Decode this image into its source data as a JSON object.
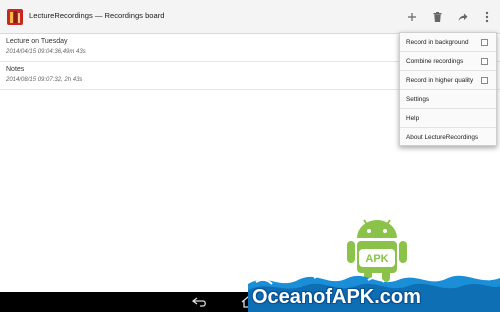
{
  "app": {
    "title": "LectureRecordings — Recordings board",
    "icon": "app-book-icon"
  },
  "toolbar": {
    "add_icon": "plus-icon",
    "delete_icon": "trash-icon",
    "share_icon": "share-icon",
    "overflow_icon": "more-vert-icon"
  },
  "recordings": [
    {
      "title": "Lecture on Tuesday",
      "subtitle": "2014/04/15 09:04:36,49m 43s"
    },
    {
      "title": "Notes",
      "subtitle": "2014/08/15 09:07:32, 2h 43s"
    }
  ],
  "menu": {
    "items": [
      {
        "label": "Record in background",
        "checkbox": true,
        "checked": false
      },
      {
        "label": "Combine recordings",
        "checkbox": true,
        "checked": false
      },
      {
        "label": "Record in higher quality",
        "checkbox": true,
        "checked": false
      },
      {
        "label": "Settings",
        "checkbox": false
      },
      {
        "label": "Help",
        "checkbox": false
      },
      {
        "label": "About LectureRecordings",
        "checkbox": false
      }
    ]
  },
  "watermark": {
    "text": "OceanofAPK.com",
    "badge": "APK"
  },
  "colors": {
    "action_bar": "#f4f4f4",
    "nav_bar": "#000000",
    "android_green": "#8bc34a",
    "ocean_blue": "#1a8fd8"
  }
}
